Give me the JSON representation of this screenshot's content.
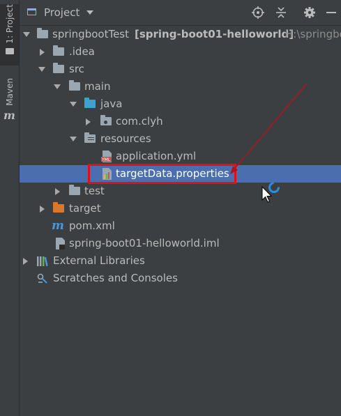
{
  "side_strip": {
    "project_tab_label": "1: Project",
    "maven_tab_label": "Maven"
  },
  "header": {
    "title": "Project",
    "buttons": [
      "locate-icon",
      "collapse-icon",
      "gear-icon",
      "minimize-icon"
    ]
  },
  "tree": [
    {
      "label": "springbootTest",
      "module": "[spring-boot01-helloworld]",
      "path": "H:\\springbo",
      "icon": "module-folder-icon",
      "expanded": true
    },
    {
      "label": ".idea",
      "icon": "folder-icon",
      "expanded": false
    },
    {
      "label": "src",
      "icon": "folder-icon",
      "expanded": true
    },
    {
      "label": "main",
      "icon": "folder-icon",
      "expanded": true
    },
    {
      "label": "java",
      "icon": "source-folder-icon",
      "expanded": true
    },
    {
      "label": "com.clyh",
      "icon": "package-icon",
      "expanded": false
    },
    {
      "label": "resources",
      "icon": "resources-folder-icon",
      "expanded": true
    },
    {
      "label": "application.yml",
      "icon": "yml-file-icon"
    },
    {
      "label": "targetData.properties",
      "icon": "properties-file-icon",
      "selected": true
    },
    {
      "label": "test",
      "icon": "folder-icon",
      "expanded": false
    },
    {
      "label": "target",
      "icon": "excluded-folder-icon",
      "expanded": false
    },
    {
      "label": "pom.xml",
      "icon": "maven-icon"
    },
    {
      "label": "spring-boot01-helloworld.iml",
      "icon": "iml-file-icon"
    },
    {
      "label": "External Libraries",
      "icon": "libraries-icon",
      "expanded": false
    },
    {
      "label": "Scratches and Consoles",
      "icon": "scratches-icon"
    }
  ],
  "colors": {
    "background": "#3c3f41",
    "selection": "#4b6eaf",
    "annotation": "#e0101a"
  }
}
